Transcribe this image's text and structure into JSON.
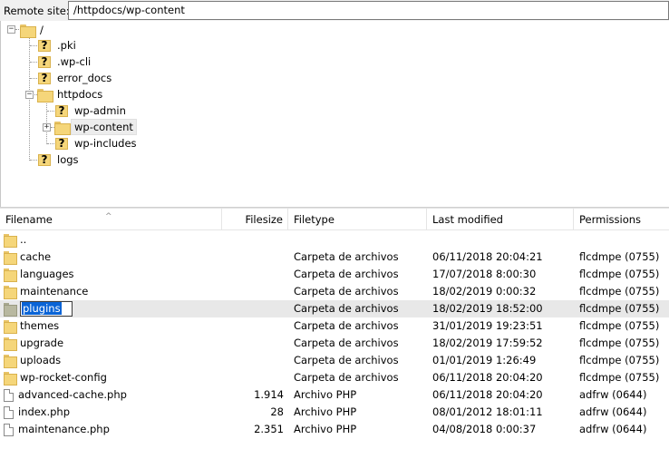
{
  "remote": {
    "label": "Remote site:",
    "path": "/httpdocs/wp-content"
  },
  "tree": {
    "root": "/",
    "items": [
      {
        "label": ".pki",
        "icon": "unknown-folder-icon"
      },
      {
        "label": ".wp-cli",
        "icon": "unknown-folder-icon"
      },
      {
        "label": "error_docs",
        "icon": "unknown-folder-icon"
      },
      {
        "label": "httpdocs",
        "icon": "folder-icon"
      },
      {
        "label": "wp-admin",
        "icon": "unknown-folder-icon"
      },
      {
        "label": "wp-content",
        "icon": "folder-icon"
      },
      {
        "label": "wp-includes",
        "icon": "unknown-folder-icon"
      },
      {
        "label": "logs",
        "icon": "unknown-folder-icon"
      }
    ],
    "expand_minus": "−",
    "expand_plus": "+",
    "unknown_mark": "?"
  },
  "filelist": {
    "columns": {
      "filename": "Filename",
      "filesize": "Filesize",
      "filetype": "Filetype",
      "modified": "Last modified",
      "permissions": "Permissions"
    },
    "rows": [
      {
        "name": "..",
        "size": "",
        "type": "",
        "modified": "",
        "perms": "",
        "kind": "folder"
      },
      {
        "name": "cache",
        "size": "",
        "type": "Carpeta de archivos",
        "modified": "06/11/2018 20:04:21",
        "perms": "flcdmpe (0755)",
        "kind": "folder"
      },
      {
        "name": "languages",
        "size": "",
        "type": "Carpeta de archivos",
        "modified": "17/07/2018 8:00:30",
        "perms": "flcdmpe (0755)",
        "kind": "folder"
      },
      {
        "name": "maintenance",
        "size": "",
        "type": "Carpeta de archivos",
        "modified": "18/02/2019 0:00:32",
        "perms": "flcdmpe (0755)",
        "kind": "folder"
      },
      {
        "name": "plugins",
        "size": "",
        "type": "Carpeta de archivos",
        "modified": "18/02/2019 18:52:00",
        "perms": "flcdmpe (0755)",
        "kind": "folder"
      },
      {
        "name": "themes",
        "size": "",
        "type": "Carpeta de archivos",
        "modified": "31/01/2019 19:23:51",
        "perms": "flcdmpe (0755)",
        "kind": "folder"
      },
      {
        "name": "upgrade",
        "size": "",
        "type": "Carpeta de archivos",
        "modified": "18/02/2019 17:59:52",
        "perms": "flcdmpe (0755)",
        "kind": "folder"
      },
      {
        "name": "uploads",
        "size": "",
        "type": "Carpeta de archivos",
        "modified": "01/01/2019 1:26:49",
        "perms": "flcdmpe (0755)",
        "kind": "folder"
      },
      {
        "name": "wp-rocket-config",
        "size": "",
        "type": "Carpeta de archivos",
        "modified": "06/11/2018 20:04:20",
        "perms": "flcdmpe (0755)",
        "kind": "folder"
      },
      {
        "name": "advanced-cache.php",
        "size": "1.914",
        "type": "Archivo PHP",
        "modified": "06/11/2018 20:04:20",
        "perms": "adfrw (0644)",
        "kind": "file"
      },
      {
        "name": "index.php",
        "size": "28",
        "type": "Archivo PHP",
        "modified": "08/01/2012 18:01:11",
        "perms": "adfrw (0644)",
        "kind": "file"
      },
      {
        "name": "maintenance.php",
        "size": "2.351",
        "type": "Archivo PHP",
        "modified": "04/08/2018 0:00:37",
        "perms": "adfrw (0644)",
        "kind": "file"
      }
    ]
  }
}
